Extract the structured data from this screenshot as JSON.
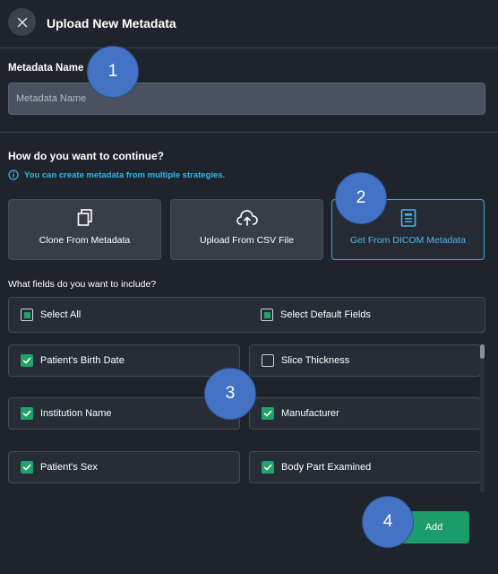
{
  "header": {
    "title": "Upload New Metadata"
  },
  "metadata_name": {
    "label": "Metadata Name",
    "placeholder": "Metadata Name",
    "value": ""
  },
  "strategy": {
    "title": "How do you want to continue?",
    "info": "You can create metadata from multiple strategies.",
    "options": [
      {
        "label": "Clone From Metadata",
        "icon": "copy-icon",
        "selected": false
      },
      {
        "label": "Upload From CSV File",
        "icon": "cloud-upload-icon",
        "selected": false
      },
      {
        "label": "Get From DICOM Metadata",
        "icon": "document-icon",
        "selected": true
      }
    ]
  },
  "fields": {
    "title": "What fields do you want to include?",
    "select_all": "Select All",
    "select_default": "Select Default Fields",
    "items": [
      {
        "label": "Patient's Birth Date",
        "checked": true
      },
      {
        "label": "Slice Thickness",
        "checked": false
      },
      {
        "label": "Institution Name",
        "checked": true
      },
      {
        "label": "Manufacturer",
        "checked": true
      },
      {
        "label": "Patient's Sex",
        "checked": true
      },
      {
        "label": "Body Part Examined",
        "checked": true
      }
    ]
  },
  "actions": {
    "add": "Add"
  },
  "markers": [
    "1",
    "2",
    "3",
    "4"
  ],
  "colors": {
    "accent": "#1a9d6a",
    "info": "#35b8e6",
    "active_border": "#4ea8d4",
    "marker": "#4472c4"
  }
}
